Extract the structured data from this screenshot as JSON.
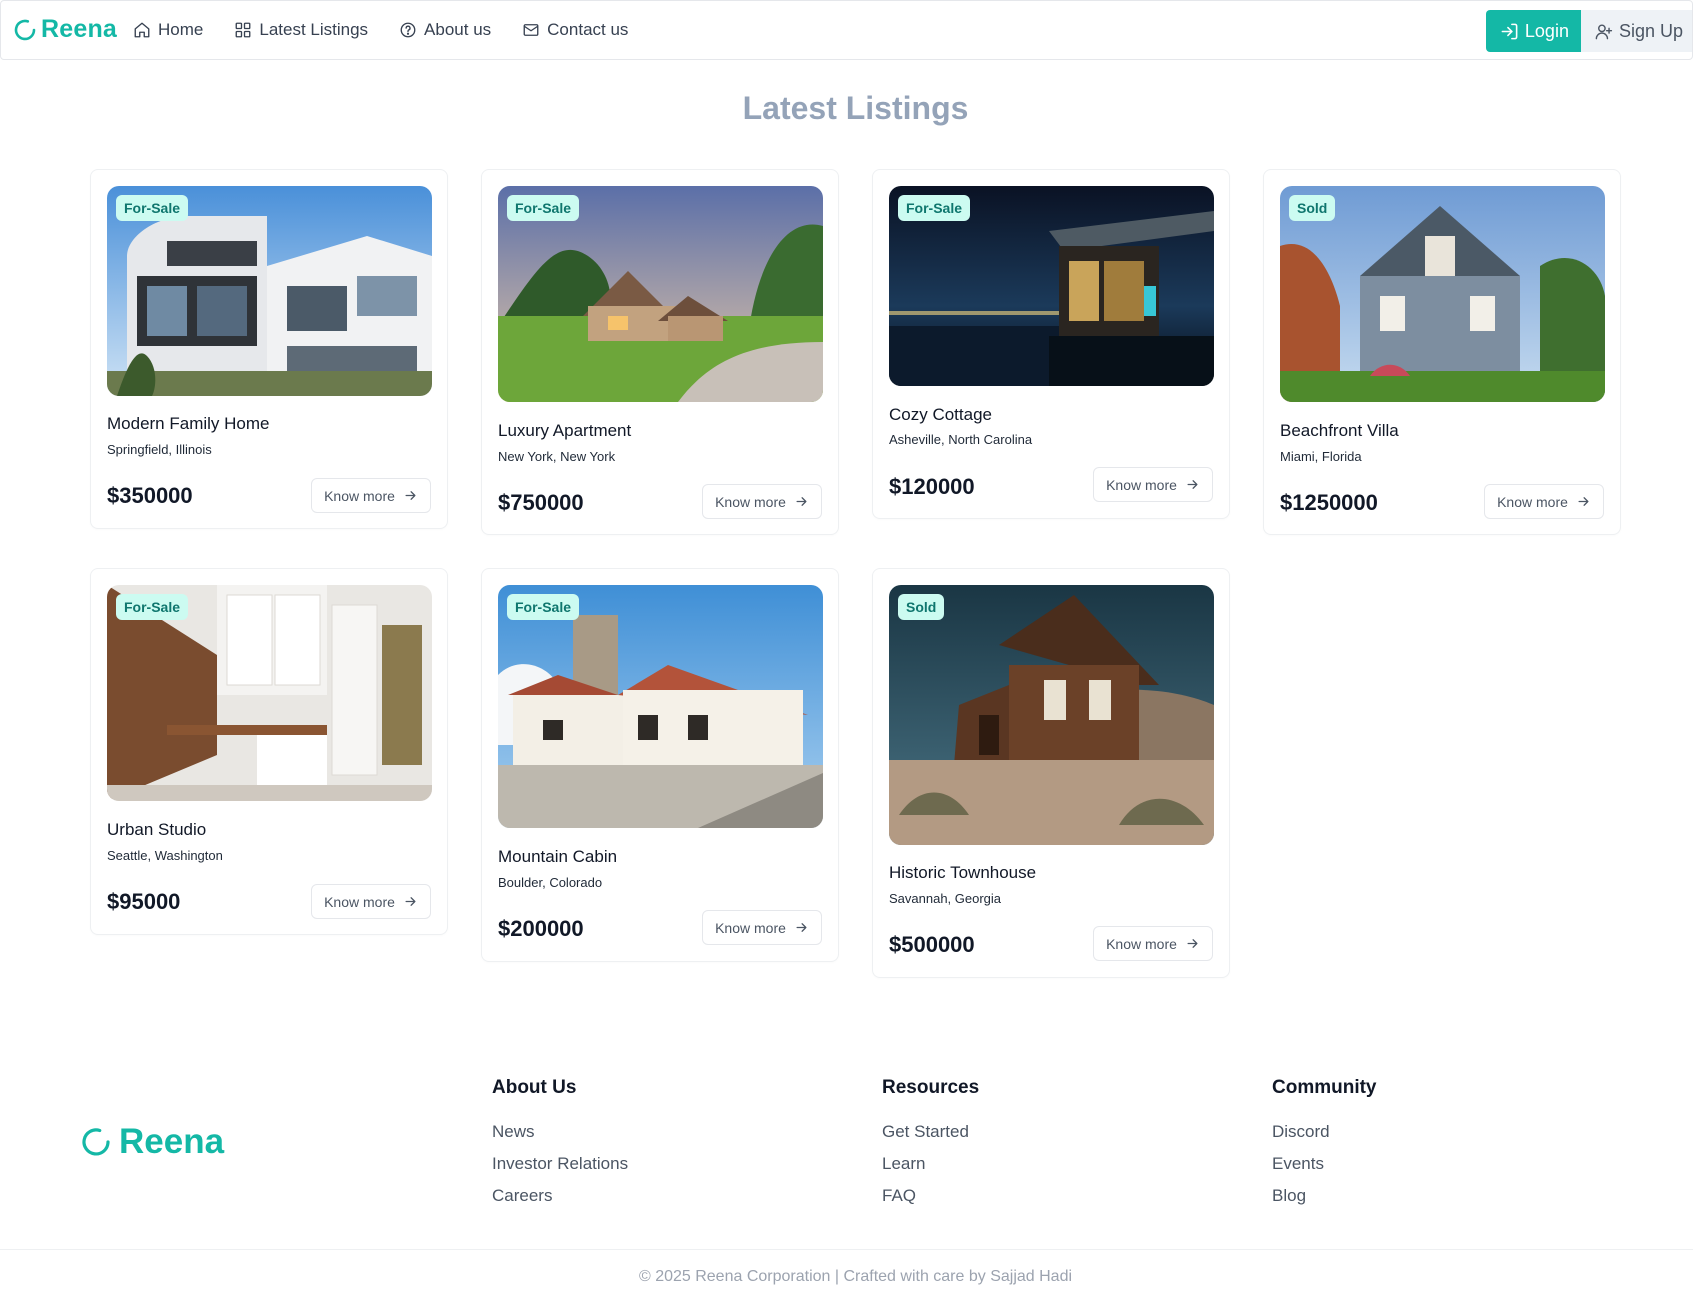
{
  "brand": {
    "name": "Reena",
    "color": "#14b8a6"
  },
  "nav": {
    "links": [
      {
        "label": "Home",
        "icon": "home-icon"
      },
      {
        "label": "Latest Listings",
        "icon": "grid-icon"
      },
      {
        "label": "About us",
        "icon": "help-circle-icon"
      },
      {
        "label": "Contact us",
        "icon": "mail-icon"
      }
    ],
    "login_label": "Login",
    "signup_label": "Sign Up"
  },
  "page": {
    "title": "Latest Listings"
  },
  "listings": [
    {
      "status": "For-Sale",
      "title": "Modern Family Home",
      "location": "Springfield, Illinois",
      "price": "$350000",
      "cta": "Know more",
      "image": "modern-house-photo"
    },
    {
      "status": "For-Sale",
      "title": "Luxury Apartment",
      "location": "New York, New York",
      "price": "$750000",
      "cta": "Know more",
      "image": "country-house-photo"
    },
    {
      "status": "For-Sale",
      "title": "Cozy Cottage",
      "location": "Asheville, North Carolina",
      "price": "$120000",
      "cta": "Know more",
      "image": "night-waterfront-photo"
    },
    {
      "status": "Sold",
      "title": "Beachfront Villa",
      "location": "Miami, Florida",
      "price": "$1250000",
      "cta": "Know more",
      "image": "victorian-house-photo"
    },
    {
      "status": "For-Sale",
      "title": "Urban Studio",
      "location": "Seattle, Washington",
      "price": "$95000",
      "cta": "Know more",
      "image": "kitchen-interior-photo"
    },
    {
      "status": "For-Sale",
      "title": "Mountain Cabin",
      "location": "Boulder, Colorado",
      "price": "$200000",
      "cta": "Know more",
      "image": "stone-villa-photo"
    },
    {
      "status": "Sold",
      "title": "Historic Townhouse",
      "location": "Savannah, Georgia",
      "price": "$500000",
      "cta": "Know more",
      "image": "wooden-cabin-photo"
    }
  ],
  "footer": {
    "columns": [
      {
        "title": "About Us",
        "links": [
          "News",
          "Investor Relations",
          "Careers"
        ]
      },
      {
        "title": "Resources",
        "links": [
          "Get Started",
          "Learn",
          "FAQ"
        ]
      },
      {
        "title": "Community",
        "links": [
          "Discord",
          "Events",
          "Blog"
        ]
      }
    ],
    "copyright": "© 2025 Reena Corporation | Crafted with care by Sajjad Hadi"
  }
}
